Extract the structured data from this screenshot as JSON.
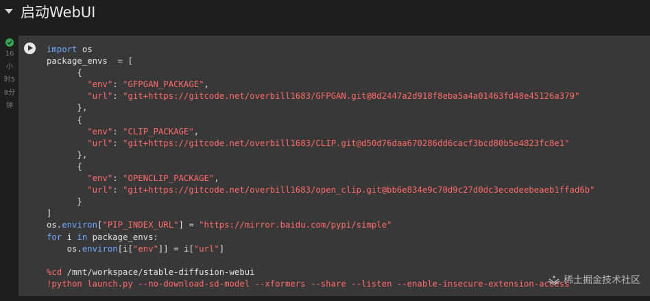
{
  "section": {
    "title": "启动WebUI"
  },
  "cell_status": {
    "time_lines": [
      "16",
      "小",
      "时5",
      "8分",
      "钟"
    ]
  },
  "code_lines": [
    [
      {
        "t": "import",
        "c": "kw"
      },
      {
        "t": " os"
      }
    ],
    [
      {
        "t": "package_envs  = ["
      }
    ],
    [
      {
        "t": "      {"
      }
    ],
    [
      {
        "t": "        "
      },
      {
        "t": "\"env\"",
        "c": "str"
      },
      {
        "t": ": "
      },
      {
        "t": "\"GFPGAN_PACKAGE\"",
        "c": "str"
      },
      {
        "t": ","
      }
    ],
    [
      {
        "t": "        "
      },
      {
        "t": "\"url\"",
        "c": "str"
      },
      {
        "t": ": "
      },
      {
        "t": "\"git+https://gitcode.net/overbill1683/GFPGAN.git@8d2447a2d918f8eba5a4a01463fd48e45126a379\"",
        "c": "str"
      }
    ],
    [
      {
        "t": "      },"
      }
    ],
    [
      {
        "t": "      {"
      }
    ],
    [
      {
        "t": "        "
      },
      {
        "t": "\"env\"",
        "c": "str"
      },
      {
        "t": ": "
      },
      {
        "t": "\"CLIP_PACKAGE\"",
        "c": "str"
      },
      {
        "t": ","
      }
    ],
    [
      {
        "t": "        "
      },
      {
        "t": "\"url\"",
        "c": "str"
      },
      {
        "t": ": "
      },
      {
        "t": "\"git+https://gitcode.net/overbill1683/CLIP.git@d50d76daa670286dd6cacf3bcd80b5e4823fc8e1\"",
        "c": "str"
      }
    ],
    [
      {
        "t": "      },"
      }
    ],
    [
      {
        "t": "      {"
      }
    ],
    [
      {
        "t": "        "
      },
      {
        "t": "\"env\"",
        "c": "str"
      },
      {
        "t": ": "
      },
      {
        "t": "\"OPENCLIP_PACKAGE\"",
        "c": "str"
      },
      {
        "t": ","
      }
    ],
    [
      {
        "t": "        "
      },
      {
        "t": "\"url\"",
        "c": "str"
      },
      {
        "t": ": "
      },
      {
        "t": "\"git+https://gitcode.net/overbill1683/open_clip.git@bb6e834e9c70d9c27d0dc3ecedeebeaeb1ffad6b\"",
        "c": "str"
      }
    ],
    [
      {
        "t": "      }"
      }
    ],
    [
      {
        "t": "]"
      }
    ],
    [
      {
        "t": "os."
      },
      {
        "t": "environ",
        "c": "attr"
      },
      {
        "t": "["
      },
      {
        "t": "\"PIP_INDEX_URL\"",
        "c": "str"
      },
      {
        "t": "] = "
      },
      {
        "t": "\"https://mirror.baidu.com/pypi/simple\"",
        "c": "str"
      }
    ],
    [
      {
        "t": "for",
        "c": "kw"
      },
      {
        "t": " i "
      },
      {
        "t": "in",
        "c": "kw"
      },
      {
        "t": " package_envs:"
      }
    ],
    [
      {
        "t": "    os."
      },
      {
        "t": "environ",
        "c": "attr"
      },
      {
        "t": "[i["
      },
      {
        "t": "\"env\"",
        "c": "str"
      },
      {
        "t": "]] = i["
      },
      {
        "t": "\"url\"",
        "c": "str"
      },
      {
        "t": "]"
      }
    ],
    [
      {
        "t": ""
      }
    ],
    [
      {
        "t": "%cd",
        "c": "magic"
      },
      {
        "t": " /mnt/workspace/stable-diffusion-webui"
      }
    ],
    [
      {
        "t": "!python launch.py --no-download-sd-model --xformers --share --listen --enable-insecure-extension-access",
        "c": "magic"
      }
    ]
  ],
  "watermark": {
    "text": "稀土掘金技术社区"
  },
  "colors": {
    "keyword": "#6ea8ff",
    "string": "#ff6b6b",
    "cell_background": "#383838",
    "page_background": "#1e1e1e",
    "status_ok": "#34a853"
  }
}
